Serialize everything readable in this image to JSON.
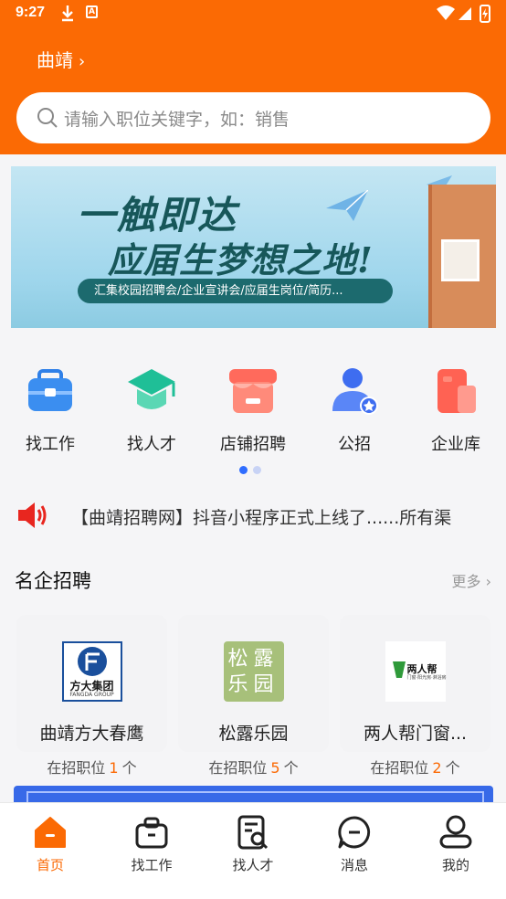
{
  "status_bar": {
    "time": "9:27",
    "app_badge": "A"
  },
  "header": {
    "city": "曲靖",
    "city_chevron": "›"
  },
  "search": {
    "placeholder": "请输入职位关键字，如：销售"
  },
  "banner": {
    "title_line1": "一触即达",
    "title_line2": "应届生梦想之地!",
    "subtitle": "汇集校园招聘会/企业宣讲会/应届生岗位/简历..."
  },
  "quick_menu": [
    {
      "label": "找工作",
      "icon": "briefcase-icon"
    },
    {
      "label": "找人才",
      "icon": "graduation-cap-icon"
    },
    {
      "label": "店铺招聘",
      "icon": "store-icon"
    },
    {
      "label": "公招",
      "icon": "person-badge-icon"
    },
    {
      "label": "企业库",
      "icon": "building-icon"
    }
  ],
  "pager": {
    "count": 2,
    "active": 0
  },
  "notice": {
    "text": "【曲靖招聘网】抖音小程序正式上线了......所有渠"
  },
  "featured": {
    "title": "名企招聘",
    "more_label": "更多",
    "companies": [
      {
        "name": "曲靖方大春鹰",
        "open_label": "在招职位",
        "count": "1",
        "unit": "个",
        "logo_text": "方大集团",
        "logo_sub": "FANGDA GROUP"
      },
      {
        "name": "松露乐园",
        "open_label": "在招职位",
        "count": "5",
        "unit": "个",
        "logo_text": "松露乐园"
      },
      {
        "name": "两人帮门窗...",
        "open_label": "在招职位",
        "count": "2",
        "unit": "个",
        "logo_text": "两人帮",
        "logo_sub": "门窗·阳光房·淋浴房"
      }
    ]
  },
  "tabs": [
    {
      "label": "首页",
      "icon": "home-icon",
      "active": true
    },
    {
      "label": "找工作",
      "icon": "briefcase-outline-icon",
      "active": false
    },
    {
      "label": "找人才",
      "icon": "resume-search-icon",
      "active": false
    },
    {
      "label": "消息",
      "icon": "chat-bubble-icon",
      "active": false
    },
    {
      "label": "我的",
      "icon": "profile-icon",
      "active": false
    }
  ],
  "colors": {
    "brand": "#fb6a04",
    "accent_blue": "#2f6dff"
  }
}
